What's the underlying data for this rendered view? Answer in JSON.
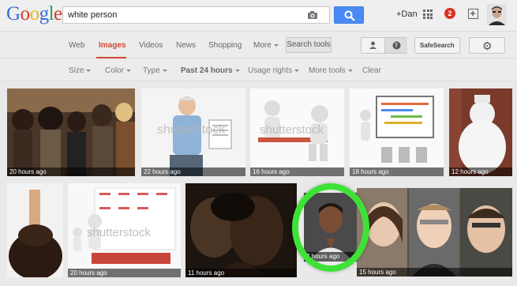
{
  "search": {
    "query": "white person",
    "logo_letters": [
      {
        "ch": "G",
        "color": "#3b6fd8"
      },
      {
        "ch": "o",
        "color": "#d8382b"
      },
      {
        "ch": "o",
        "color": "#eab51f"
      },
      {
        "ch": "g",
        "color": "#3b6fd8"
      },
      {
        "ch": "l",
        "color": "#2aa04a"
      },
      {
        "ch": "e",
        "color": "#d8382b"
      }
    ]
  },
  "header": {
    "user_link": "+Dan",
    "notification_count": "2"
  },
  "nav": {
    "tabs": [
      {
        "label": "Web",
        "active": false
      },
      {
        "label": "Images",
        "active": true
      },
      {
        "label": "Videos",
        "active": false
      },
      {
        "label": "News",
        "active": false
      },
      {
        "label": "Shopping",
        "active": false
      },
      {
        "label": "More",
        "active": false
      }
    ],
    "search_tools": "Search tools",
    "safesearch": "SafeSearch"
  },
  "filters": [
    {
      "label": "Size",
      "caret": true,
      "bold": false
    },
    {
      "label": "Color",
      "caret": true,
      "bold": false
    },
    {
      "label": "Type",
      "caret": true,
      "bold": false
    },
    {
      "label": "Past 24 hours",
      "caret": true,
      "bold": true
    },
    {
      "label": "Usage rights",
      "caret": true,
      "bold": false
    },
    {
      "label": "More tools",
      "caret": true,
      "bold": false
    },
    {
      "label": "Clear",
      "caret": false,
      "bold": false
    }
  ],
  "results": [
    {
      "caption": "20 hours ago",
      "watermark": ""
    },
    {
      "caption": "22 hours ago",
      "watermark": "shutterstock"
    },
    {
      "caption": "16 hours ago",
      "watermark": "shutterstock"
    },
    {
      "caption": "18 hours ago",
      "watermark": ""
    },
    {
      "caption": "12 hours ago",
      "watermark": ""
    },
    {
      "caption": "",
      "watermark": ""
    },
    {
      "caption": "20 hours ago",
      "watermark": "shutterstock"
    },
    {
      "caption": "11 hours ago",
      "watermark": ""
    },
    {
      "caption": "3 hours ago",
      "watermark": ""
    },
    {
      "caption": "15 hours ago",
      "watermark": ""
    }
  ],
  "colors": {
    "accent_red": "#d14836",
    "search_blue": "#4a8af4",
    "highlight_green": "#3ee236"
  }
}
